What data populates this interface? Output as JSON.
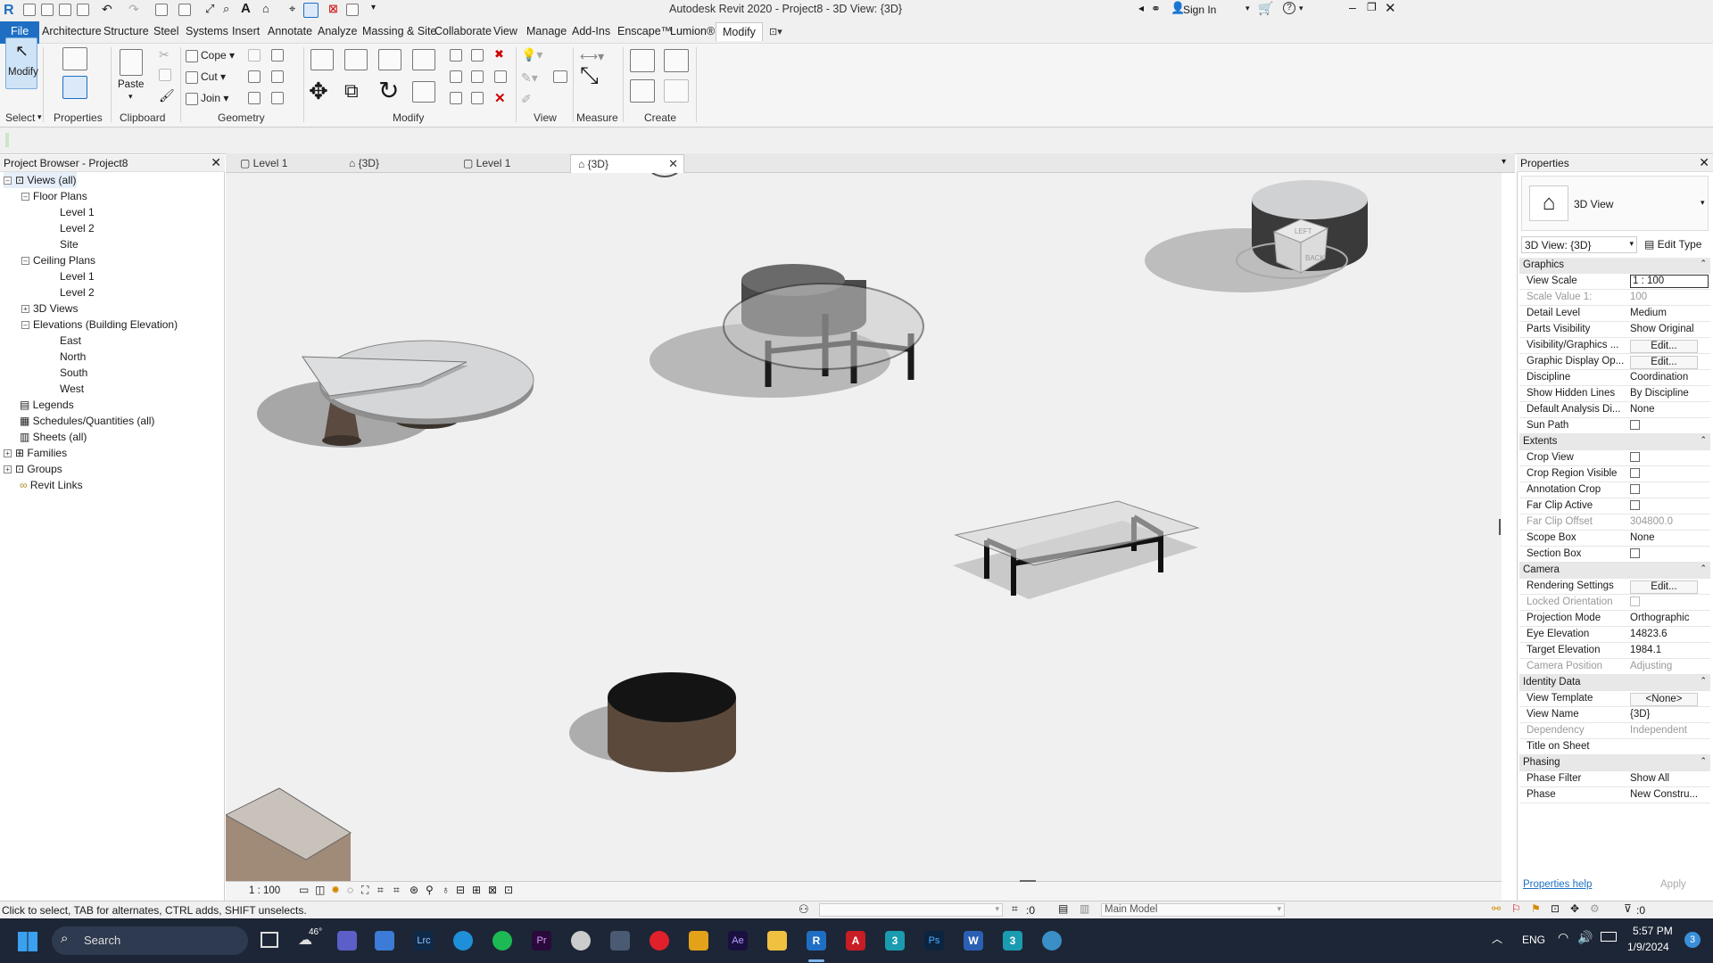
{
  "title_bar": {
    "app_title": "Autodesk Revit 2020 - Project8 - 3D View: {3D}",
    "sign_in": "Sign In"
  },
  "menu": {
    "file": "File",
    "items": [
      "Architecture",
      "Structure",
      "Steel",
      "Systems",
      "Insert",
      "Annotate",
      "Analyze",
      "Massing & Site",
      "Collaborate",
      "View",
      "Manage",
      "Add-Ins",
      "Enscape™",
      "Lumion®",
      "Modify"
    ]
  },
  "ribbon": {
    "modify_label": "Modify",
    "properties_label": "Properties",
    "paste_label": "Paste",
    "cope": "Cope",
    "cut": "Cut",
    "join": "Join",
    "groups": {
      "select": "Select",
      "properties": "Properties",
      "clipboard": "Clipboard",
      "geometry": "Geometry",
      "modify": "Modify",
      "view": "View",
      "measure": "Measure",
      "create": "Create"
    }
  },
  "project_browser": {
    "title": "Project Browser - Project8",
    "tree": {
      "views_all": "Views (all)",
      "floor_plans": "Floor Plans",
      "fp_level1": "Level 1",
      "fp_level2": "Level 2",
      "fp_site": "Site",
      "ceiling_plans": "Ceiling Plans",
      "cp_level1": "Level 1",
      "cp_level2": "Level 2",
      "views_3d": "3D Views",
      "elevations": "Elevations (Building Elevation)",
      "east": "East",
      "north": "North",
      "south": "South",
      "west": "West",
      "legends": "Legends",
      "schedules": "Schedules/Quantities (all)",
      "sheets": "Sheets (all)",
      "families": "Families",
      "groups": "Groups",
      "revit_links": "Revit Links"
    }
  },
  "view_tabs": [
    {
      "label": "Level 1"
    },
    {
      "label": "{3D}"
    },
    {
      "label": "Level 1"
    },
    {
      "label": "{3D}"
    }
  ],
  "canvas": {
    "viewcube_top": "LEFT",
    "viewcube_side": "BACK"
  },
  "view_control_bar": {
    "scale": "1 : 100"
  },
  "properties": {
    "title": "Properties",
    "type_name": "3D View",
    "selector": "3D View: {3D}",
    "edit_type": "Edit Type",
    "sections": {
      "graphics": "Graphics",
      "extents": "Extents",
      "camera": "Camera",
      "identity": "Identity Data",
      "phasing": "Phasing"
    },
    "rows": {
      "view_scale": [
        "View Scale",
        "1 : 100"
      ],
      "scale_value": [
        "Scale Value    1:",
        "100"
      ],
      "detail_level": [
        "Detail Level",
        "Medium"
      ],
      "parts_visibility": [
        "Parts Visibility",
        "Show Original"
      ],
      "vis_graphics": [
        "Visibility/Graphics ...",
        "Edit..."
      ],
      "graphic_display": [
        "Graphic Display Op...",
        "Edit..."
      ],
      "discipline": [
        "Discipline",
        "Coordination"
      ],
      "hidden_lines": [
        "Show Hidden Lines",
        "By Discipline"
      ],
      "analysis_display": [
        "Default Analysis Di...",
        "None"
      ],
      "sun_path": [
        "Sun Path",
        ""
      ],
      "crop_view": [
        "Crop View",
        ""
      ],
      "crop_region": [
        "Crop Region Visible",
        ""
      ],
      "annotation_crop": [
        "Annotation Crop",
        ""
      ],
      "far_clip_active": [
        "Far Clip Active",
        ""
      ],
      "far_clip_offset": [
        "Far Clip Offset",
        "304800.0"
      ],
      "scope_box": [
        "Scope Box",
        "None"
      ],
      "section_box": [
        "Section Box",
        ""
      ],
      "rendering_settings": [
        "Rendering Settings",
        "Edit..."
      ],
      "locked_orientation": [
        "Locked Orientation",
        ""
      ],
      "projection_mode": [
        "Projection Mode",
        "Orthographic"
      ],
      "eye_elevation": [
        "Eye Elevation",
        "14823.6"
      ],
      "target_elevation": [
        "Target Elevation",
        "1984.1"
      ],
      "camera_position": [
        "Camera Position",
        "Adjusting"
      ],
      "view_template": [
        "View Template",
        "<None>"
      ],
      "view_name": [
        "View Name",
        "{3D}"
      ],
      "dependency": [
        "Dependency",
        "Independent"
      ],
      "title_on_sheet": [
        "Title on Sheet",
        ""
      ],
      "phase_filter": [
        "Phase Filter",
        "Show All"
      ],
      "phase": [
        "Phase",
        "New Constru..."
      ]
    },
    "help_link": "Properties help",
    "apply": "Apply"
  },
  "status_bar": {
    "hint": "Click to select, TAB for alternates, CTRL adds, SHIFT unselects.",
    "count": ":0",
    "model": "Main Model",
    "filter_count": ":0"
  },
  "taskbar": {
    "search": "Search",
    "weather": "46°",
    "lang": "ENG",
    "time": "5:57 PM",
    "date": "1/9/2024",
    "notifications": "3",
    "app_badge_a": "3",
    "app_badge_b": "3"
  },
  "colors": {
    "accent": "#1e6fc4",
    "taskbar": "#1d2636",
    "canvas": "#f0f0f0"
  }
}
